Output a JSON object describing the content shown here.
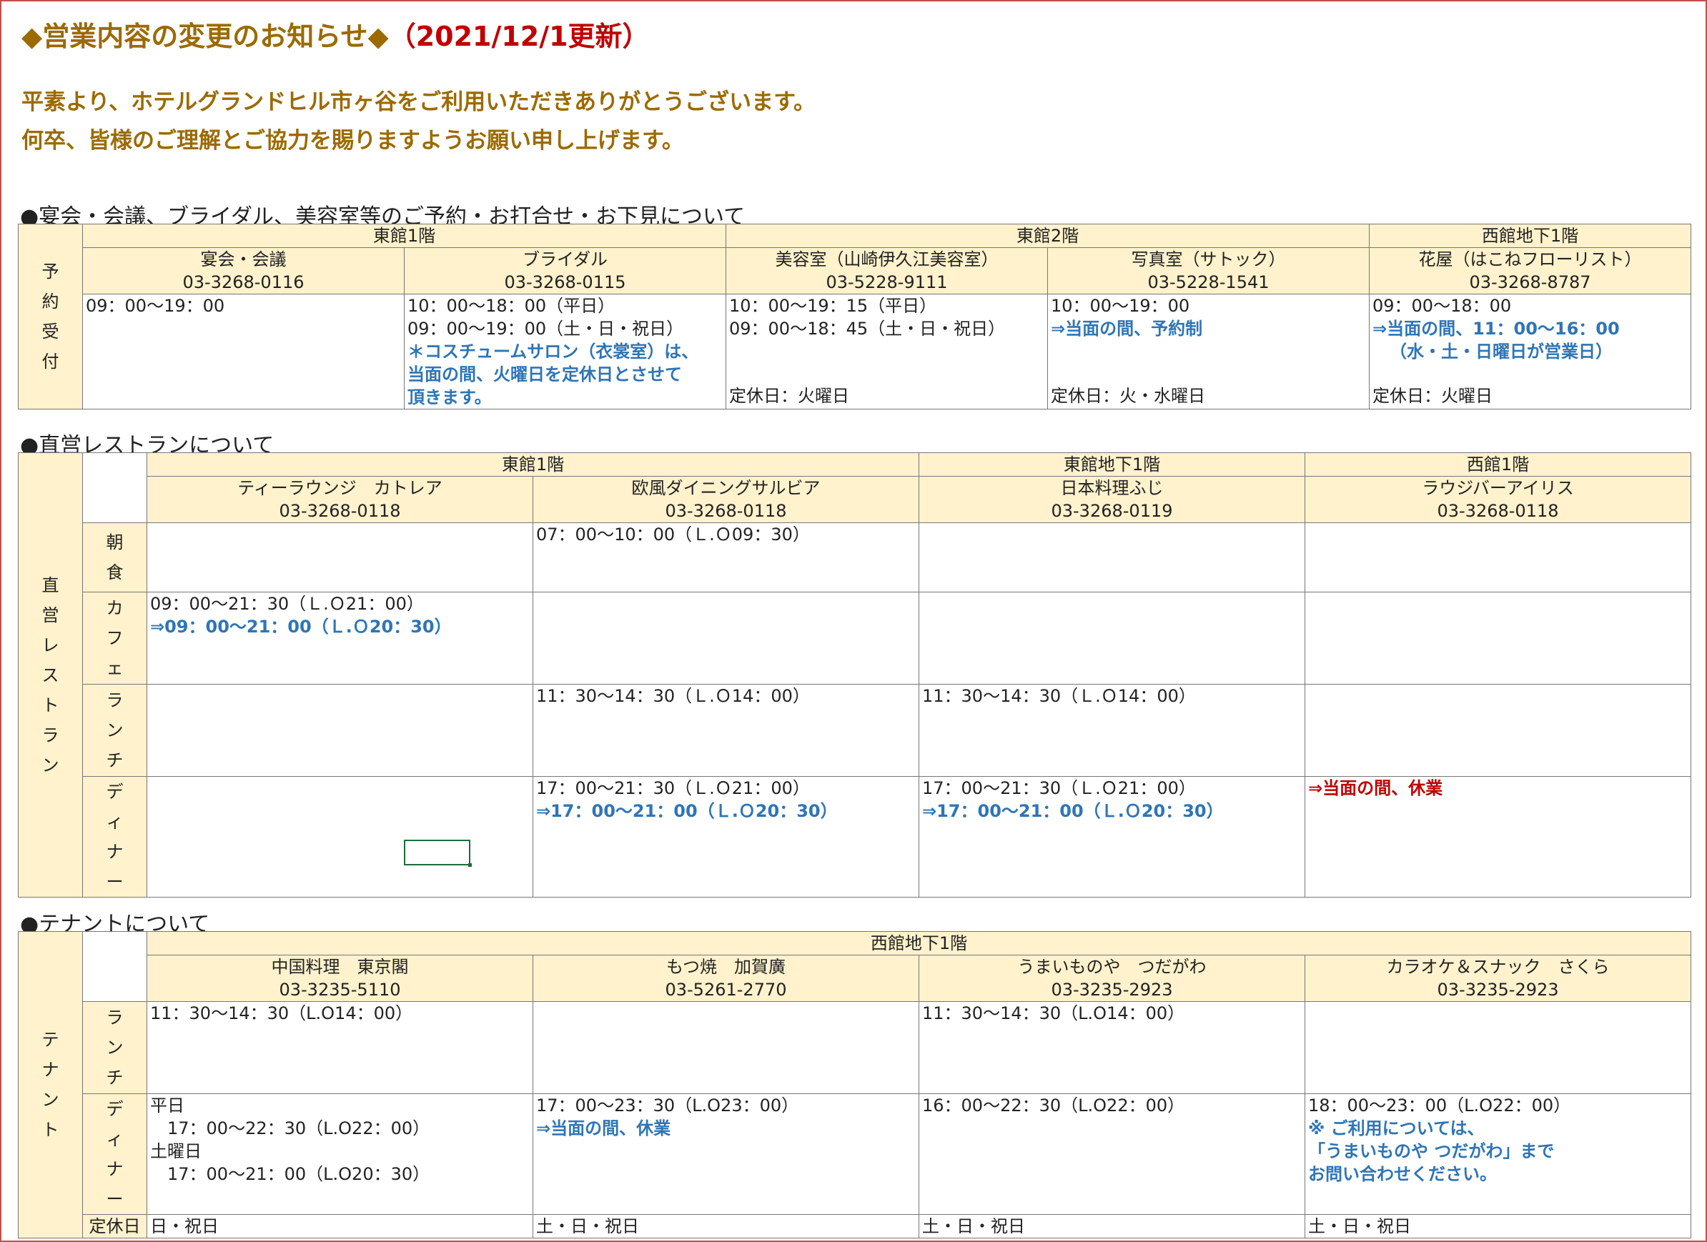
{
  "title": {
    "main": "◆営業内容の変更のお知らせ◆",
    "date": "（2021/12/1更新）"
  },
  "intro": [
    "平素より、ホテルグランドヒル市ヶ谷をご利用いただきありがとうございます。",
    "何卒、皆様のご理解とご協力を賜りますようお願い申し上げます。"
  ],
  "reservation": {
    "heading": "●宴会・会議、ブライダル、美容室等のご予約・お打合せ・お下見について",
    "side_label": [
      "予",
      "約",
      "受",
      "付"
    ],
    "floors": [
      "東館1階",
      "東館2階",
      "西館地下1階"
    ],
    "venues": [
      {
        "name": "宴会・会議",
        "phone": "03-3268-0116",
        "lines": [
          {
            "t": "09：00〜19：00",
            "c": ""
          }
        ],
        "closed": ""
      },
      {
        "name": "ブライダル",
        "phone": "03-3268-0115",
        "lines": [
          {
            "t": "10：00〜18：00（平日）",
            "c": ""
          },
          {
            "t": "09：00〜19：00（土・日・祝日）",
            "c": ""
          },
          {
            "t": "＊コスチュームサロン（衣裳室）は、",
            "c": "blue"
          },
          {
            "t": "当面の間、火曜日を定休日とさせて",
            "c": "blue"
          },
          {
            "t": "頂きます。",
            "c": "blue"
          }
        ],
        "closed": ""
      },
      {
        "name": "美容室（山崎伊久江美容室）",
        "phone": "03-5228-9111",
        "lines": [
          {
            "t": "10：00〜19：15（平日）",
            "c": ""
          },
          {
            "t": "09：00〜18：45（土・日・祝日）",
            "c": ""
          }
        ],
        "closed": "定休日：火曜日"
      },
      {
        "name": "写真室（サトック）",
        "phone": "03-5228-1541",
        "lines": [
          {
            "t": "10：00〜19：00",
            "c": ""
          },
          {
            "t": "⇒当面の間、予約制",
            "c": "blue"
          }
        ],
        "closed": "定休日：火・水曜日"
      },
      {
        "name": "花屋（はこねフローリスト）",
        "phone": "03-3268-8787",
        "lines": [
          {
            "t": "09：00〜18：00",
            "c": ""
          },
          {
            "t": "⇒当面の間、11：00〜16：00",
            "c": "blue"
          },
          {
            "t": "（水・土・日曜日が営業日）",
            "c": "blue indent"
          }
        ],
        "closed": "定休日：火曜日"
      }
    ]
  },
  "restaurants": {
    "heading": "●直営レストランについて",
    "side_label": [
      "直",
      "営",
      "レ",
      "ス",
      "ト",
      "ラ",
      "ン"
    ],
    "floors": [
      "東館1階",
      "東館地下1階",
      "西館1階"
    ],
    "venues": [
      {
        "name": "ティーラウンジ　カトレア",
        "phone": "03-3268-0118"
      },
      {
        "name": "欧風ダイニングサルビア",
        "phone": "03-3268-0118"
      },
      {
        "name": "日本料理ふじ",
        "phone": "03-3268-0119"
      },
      {
        "name": "ラウジバーアイリス",
        "phone": "03-3268-0118"
      }
    ],
    "meals": [
      {
        "label": [
          "朝",
          "食"
        ],
        "cells": [
          [],
          [
            {
              "t": "07：00〜10：00（Ｌ.Ｏ09：30）",
              "c": ""
            }
          ],
          [],
          []
        ]
      },
      {
        "label": [
          "カ",
          "フ",
          "ェ"
        ],
        "cells": [
          [
            {
              "t": "09：00〜21：30（Ｌ.Ｏ21：00）",
              "c": ""
            },
            {
              "t": "⇒09：00〜21：00（Ｌ.Ｏ20：30）",
              "c": "blue"
            }
          ],
          [],
          [],
          []
        ]
      },
      {
        "label": [
          "ラ",
          "ン",
          "チ"
        ],
        "cells": [
          [],
          [
            {
              "t": "11：30〜14：30（Ｌ.Ｏ14：00）",
              "c": ""
            }
          ],
          [
            {
              "t": "11：30〜14：30（Ｌ.Ｏ14：00）",
              "c": ""
            }
          ],
          []
        ]
      },
      {
        "label": [
          "デ",
          "ィ",
          "ナ",
          "ー"
        ],
        "cells": [
          [],
          [
            {
              "t": "17：00〜21：30（Ｌ.Ｏ21：00）",
              "c": ""
            },
            {
              "t": "⇒17：00〜21：00（Ｌ.Ｏ20：30）",
              "c": "blue"
            }
          ],
          [
            {
              "t": "17：00〜21：30（Ｌ.Ｏ21：00）",
              "c": ""
            },
            {
              "t": "⇒17：00〜21：00（Ｌ.Ｏ20：30）",
              "c": "blue"
            }
          ],
          [
            {
              "t": "⇒当面の間、休業",
              "c": "red"
            }
          ]
        ]
      }
    ]
  },
  "tenants": {
    "heading": "●テナントについて",
    "side_label": [
      "テ",
      "ナ",
      "ン",
      "ト"
    ],
    "floor": "西館地下1階",
    "venues": [
      {
        "name": "中国料理　東京閣",
        "phone": "03-3235-5110"
      },
      {
        "name": "もつ焼　加賀廣",
        "phone": "03-5261-2770"
      },
      {
        "name": "うまいものや　つだがわ",
        "phone": "03-3235-2923"
      },
      {
        "name": "カラオケ＆スナック　さくら",
        "phone": "03-3235-2923"
      }
    ],
    "meals": [
      {
        "label": [
          "ラ",
          "ン",
          "チ"
        ],
        "cells": [
          [
            {
              "t": "11：30〜14：30（L.O14：00）",
              "c": ""
            }
          ],
          [],
          [
            {
              "t": "11：30〜14：30（L.O14：00）",
              "c": ""
            }
          ],
          []
        ]
      },
      {
        "label": [
          "デ",
          "ィ",
          "ナ",
          "ー"
        ],
        "cells": [
          [
            {
              "t": "平日",
              "c": ""
            },
            {
              "t": "17：00〜22：30（L.O22：00）",
              "c": "indent"
            },
            {
              "t": "土曜日",
              "c": ""
            },
            {
              "t": "17：00〜21：00（L.O20：30）",
              "c": "indent"
            }
          ],
          [
            {
              "t": "17：00〜23：30（L.O23：00）",
              "c": ""
            },
            {
              "t": "⇒当面の間、休業",
              "c": "blue"
            }
          ],
          [
            {
              "t": "16：00〜22：30（L.O22：00）",
              "c": ""
            }
          ],
          [
            {
              "t": "18：00〜23：00（L.O22：00）",
              "c": ""
            },
            {
              "t": "※ ご利用については、",
              "c": "blue"
            },
            {
              "t": "「うまいものや つだがわ」まで",
              "c": "blue"
            },
            {
              "t": "お問い合わせください。",
              "c": "blue"
            }
          ]
        ]
      }
    ],
    "closed_label": "定休日",
    "closed": [
      "日・祝日",
      "土・日・祝日",
      "土・日・祝日",
      "土・日・祝日"
    ]
  }
}
